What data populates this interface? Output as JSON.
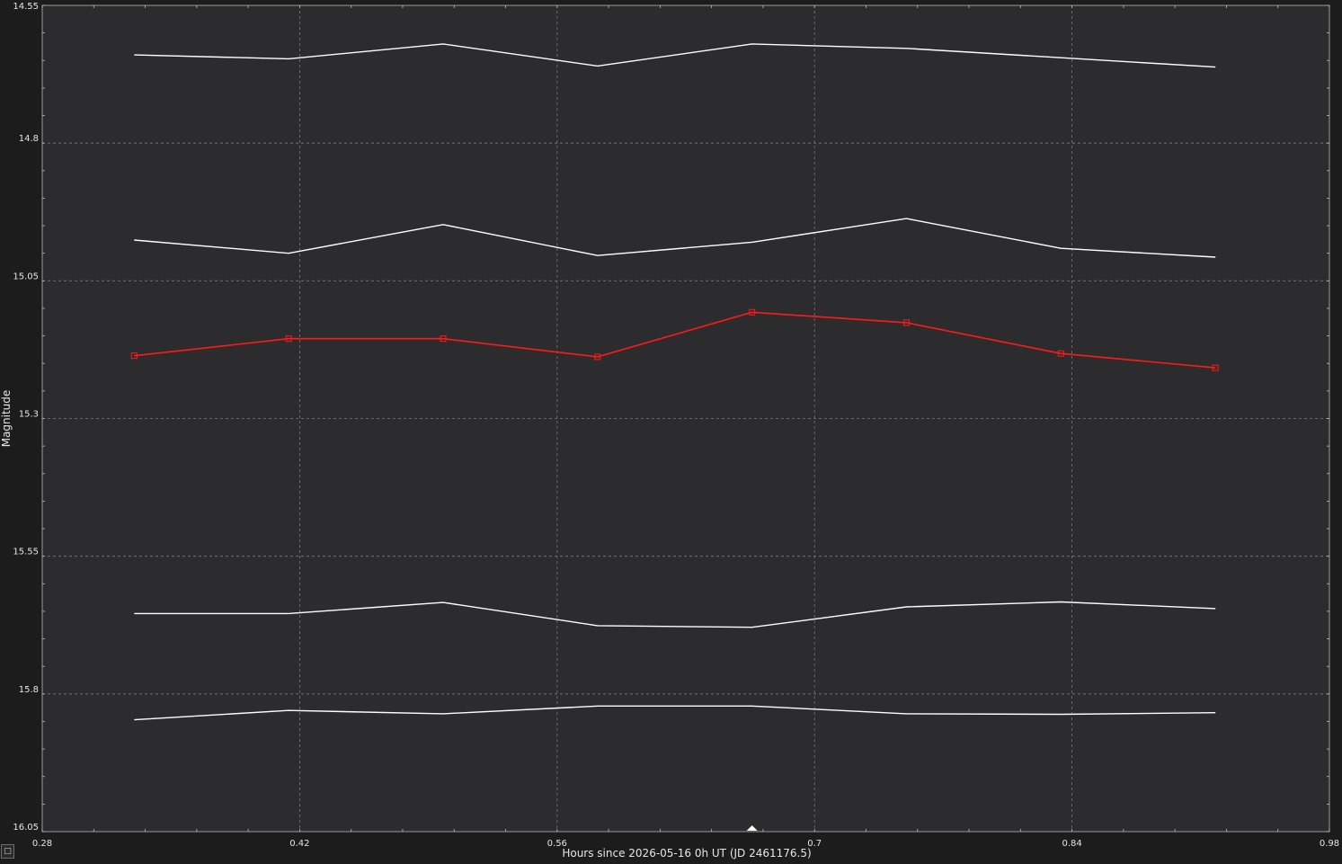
{
  "chart_data": {
    "type": "line",
    "xlabel": "Hours since 2026-05-16 0h UT (JD 2461176.5)",
    "ylabel": "Magnitude",
    "xlim": [
      0.28,
      0.98
    ],
    "ylim": [
      14.55,
      16.05
    ],
    "y_inverted": true,
    "grid": true,
    "x_ticks": [
      "0.28",
      "0.42",
      "0.56",
      "0.7",
      "0.84",
      "0.98"
    ],
    "y_ticks": [
      "14.55",
      "14.8",
      "15.05",
      "15.3",
      "15.55",
      "15.8",
      "16.05"
    ],
    "x_tick_values": [
      0.28,
      0.42,
      0.56,
      0.7,
      0.84,
      0.98
    ],
    "y_tick_values": [
      14.55,
      14.8,
      15.05,
      15.3,
      15.55,
      15.8,
      16.05
    ],
    "x": [
      0.33,
      0.414,
      0.498,
      0.582,
      0.666,
      0.75,
      0.834,
      0.918
    ],
    "series": [
      {
        "color": "#ffffff",
        "markers": false,
        "values": [
          14.64,
          14.647,
          14.62,
          14.66,
          14.62,
          14.628,
          14.645,
          14.662
        ]
      },
      {
        "color": "#ffffff",
        "markers": false,
        "values": [
          14.976,
          15.0,
          14.948,
          15.004,
          14.98,
          14.937,
          14.991,
          15.007
        ]
      },
      {
        "color": "#ff1a1a",
        "markers": true,
        "values": [
          15.186,
          15.155,
          15.155,
          15.188,
          15.107,
          15.126,
          15.182,
          15.208
        ]
      },
      {
        "color": "#ffffff",
        "markers": false,
        "values": [
          15.654,
          15.654,
          15.634,
          15.676,
          15.679,
          15.642,
          15.633,
          15.645
        ]
      },
      {
        "color": "#ffffff",
        "markers": false,
        "values": [
          15.847,
          15.83,
          15.836,
          15.822,
          15.822,
          15.836,
          15.837,
          15.834
        ]
      }
    ],
    "cursor_x": 0.666
  },
  "colors": {
    "plot_background": "#2c2c2e",
    "window_background": "#1c1c1c",
    "grid": "#7a7a7a",
    "highlight_series": "#ff1a1a",
    "comparison_series": "#ffffff"
  },
  "corner_button_glyph": "□"
}
